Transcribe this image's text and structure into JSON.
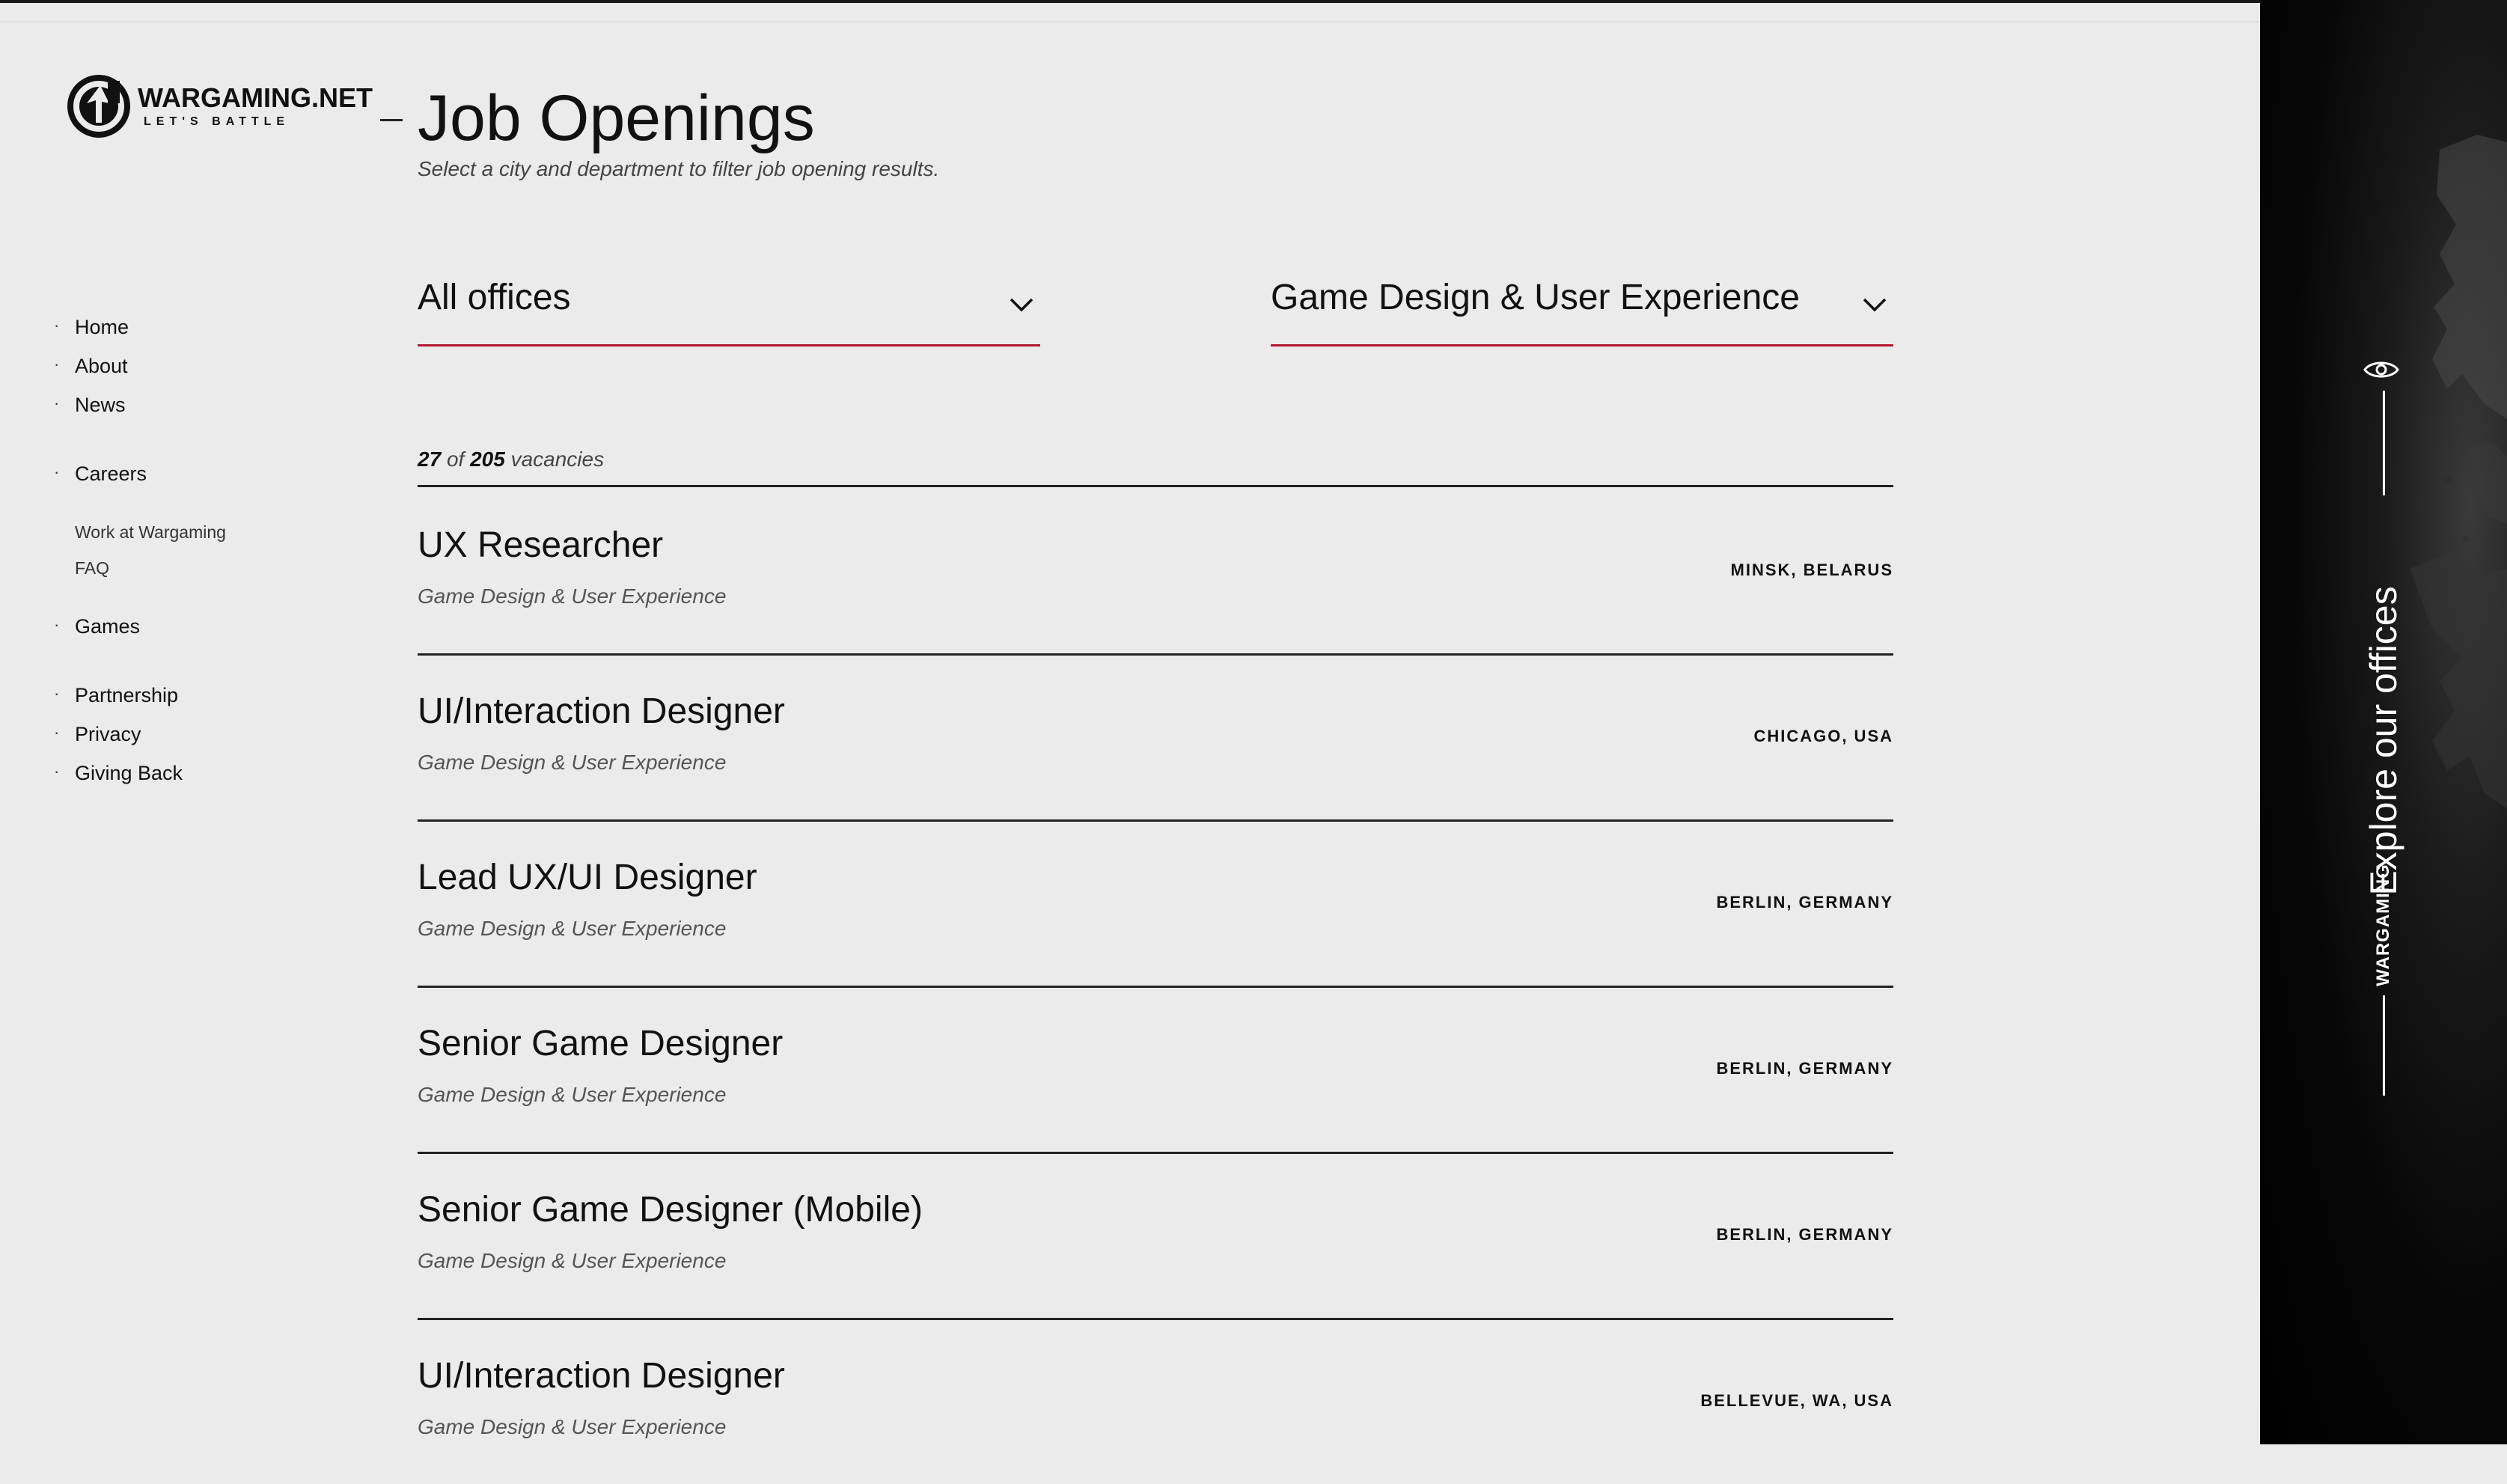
{
  "brand": {
    "name": "WARGAMING.NET",
    "tagline": "LET'S BATTLE"
  },
  "sidebar": {
    "items": [
      {
        "label": "Home"
      },
      {
        "label": "About"
      },
      {
        "label": "News"
      },
      {
        "label": "Careers"
      },
      {
        "label": "Games"
      },
      {
        "label": "Partnership"
      },
      {
        "label": "Privacy"
      },
      {
        "label": "Giving Back"
      }
    ],
    "careers_sub": [
      {
        "label": "Work at Wargaming"
      },
      {
        "label": "FAQ"
      }
    ]
  },
  "header": {
    "title": "Job Openings",
    "subtitle": "Select a city and department to filter job opening results."
  },
  "filters": {
    "office": "All offices",
    "department": "Game Design & User Experience"
  },
  "results": {
    "shown": "27",
    "of_word": "of",
    "total": "205",
    "suffix": "vacancies"
  },
  "jobs": [
    {
      "title": "UX Researcher",
      "department": "Game Design & User Experience",
      "location": "MINSK, BELARUS"
    },
    {
      "title": "UI/Interaction Designer",
      "department": "Game Design & User Experience",
      "location": "CHICAGO, USA"
    },
    {
      "title": "Lead UX/UI Designer",
      "department": "Game Design & User Experience",
      "location": "BERLIN, GERMANY"
    },
    {
      "title": "Senior Game Designer",
      "department": "Game Design & User Experience",
      "location": "BERLIN, GERMANY"
    },
    {
      "title": "Senior Game Designer (Mobile)",
      "department": "Game Design & User Experience",
      "location": "BERLIN, GERMANY"
    },
    {
      "title": "UI/Interaction Designer",
      "department": "Game Design & User Experience",
      "location": "BELLEVUE, WA, USA"
    }
  ],
  "side_panel": {
    "text": "Explore our offices",
    "brand": "WARGAMING",
    "icon": "eye-icon"
  },
  "colors": {
    "accent": "#b3182f",
    "background": "#ebebeb",
    "panel": "#000000"
  }
}
